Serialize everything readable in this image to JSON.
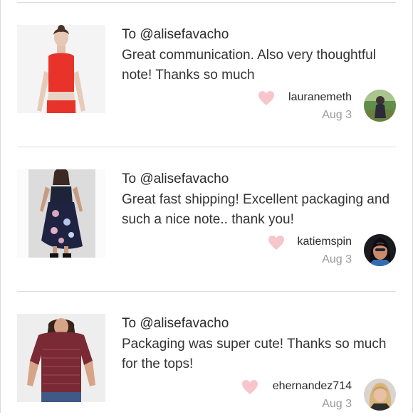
{
  "reviews": [
    {
      "to": "To @alisefavacho",
      "message": "Great communication. Also very thoughtful note! Thanks so much",
      "author": "lauranemeth",
      "date": "Aug 3",
      "thumbnail_icon": "red-crop-top-photo",
      "avatar_icon": "user-avatar-outdoor"
    },
    {
      "to": "To @alisefavacho",
      "message": "Great fast shipping! Excellent packaging and such a nice note.. thank you!",
      "author": "katiemspin",
      "date": "Aug 3",
      "thumbnail_icon": "floral-dress-photo",
      "avatar_icon": "user-avatar-selfie"
    },
    {
      "to": "To @alisefavacho",
      "message": "Packaging was super cute! Thanks so much for the tops!",
      "author": "ehernandez714",
      "date": "Aug 3",
      "thumbnail_icon": "maroon-tee-photo",
      "avatar_icon": "user-avatar-blonde"
    }
  ],
  "colors": {
    "heart": "#f7c6cc",
    "divider": "#dcdcdc",
    "text": "#333333",
    "muted": "#9a9a9a"
  }
}
